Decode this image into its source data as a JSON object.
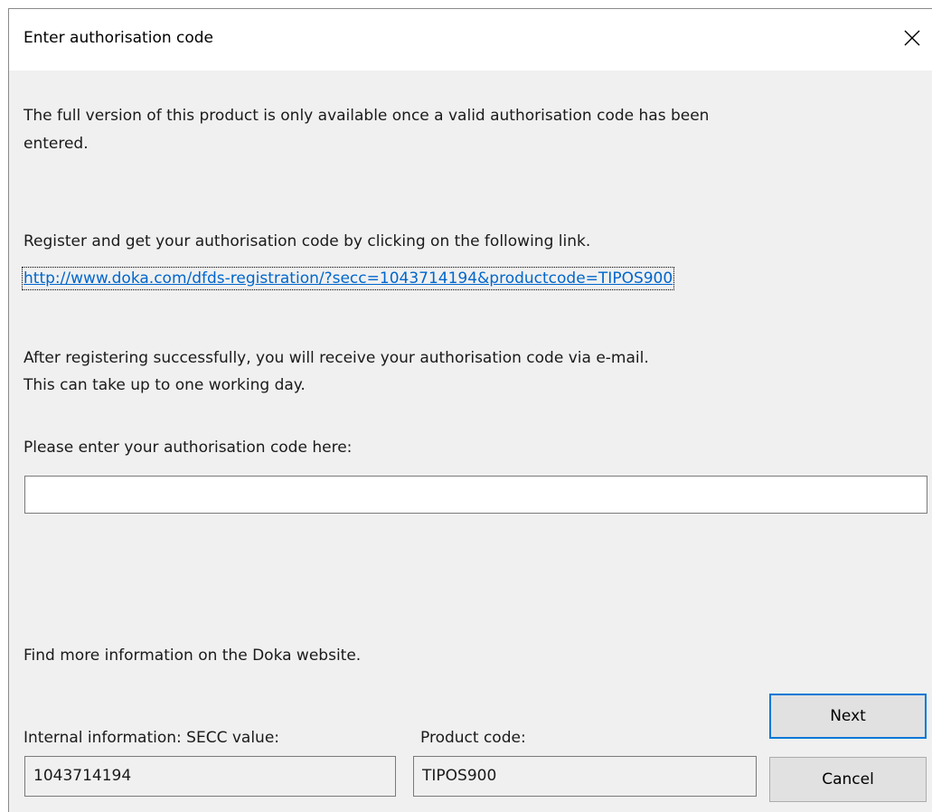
{
  "dialog": {
    "title": "Enter authorisation code",
    "intro_line1": "The full version of this product is only available once a valid authorisation code has been",
    "intro_line2": "entered.",
    "register_text": "Register and get your authorisation code by clicking on the following link.",
    "registration_link": "http://www.doka.com/dfds-registration/?secc=1043714194&productcode=TIPOS900",
    "after_line1": "After registering successfully, you will receive your authorisation code via e-mail.",
    "after_line2": "This can take up to one working day.",
    "code_prompt": "Please enter your authorisation code here:",
    "code_value": "",
    "more_info": "Find more information on the Doka website.",
    "secc_label": "Internal information: SECC value:",
    "secc_value": "1043714194",
    "product_label": "Product code:",
    "product_value": "TIPOS900",
    "next_label": "Next",
    "cancel_label": "Cancel"
  },
  "icons": {
    "close": "close-icon"
  },
  "colors": {
    "link": "#0066cc",
    "default_button_border": "#0078d7",
    "dialog_bg": "#f0f0f0"
  }
}
